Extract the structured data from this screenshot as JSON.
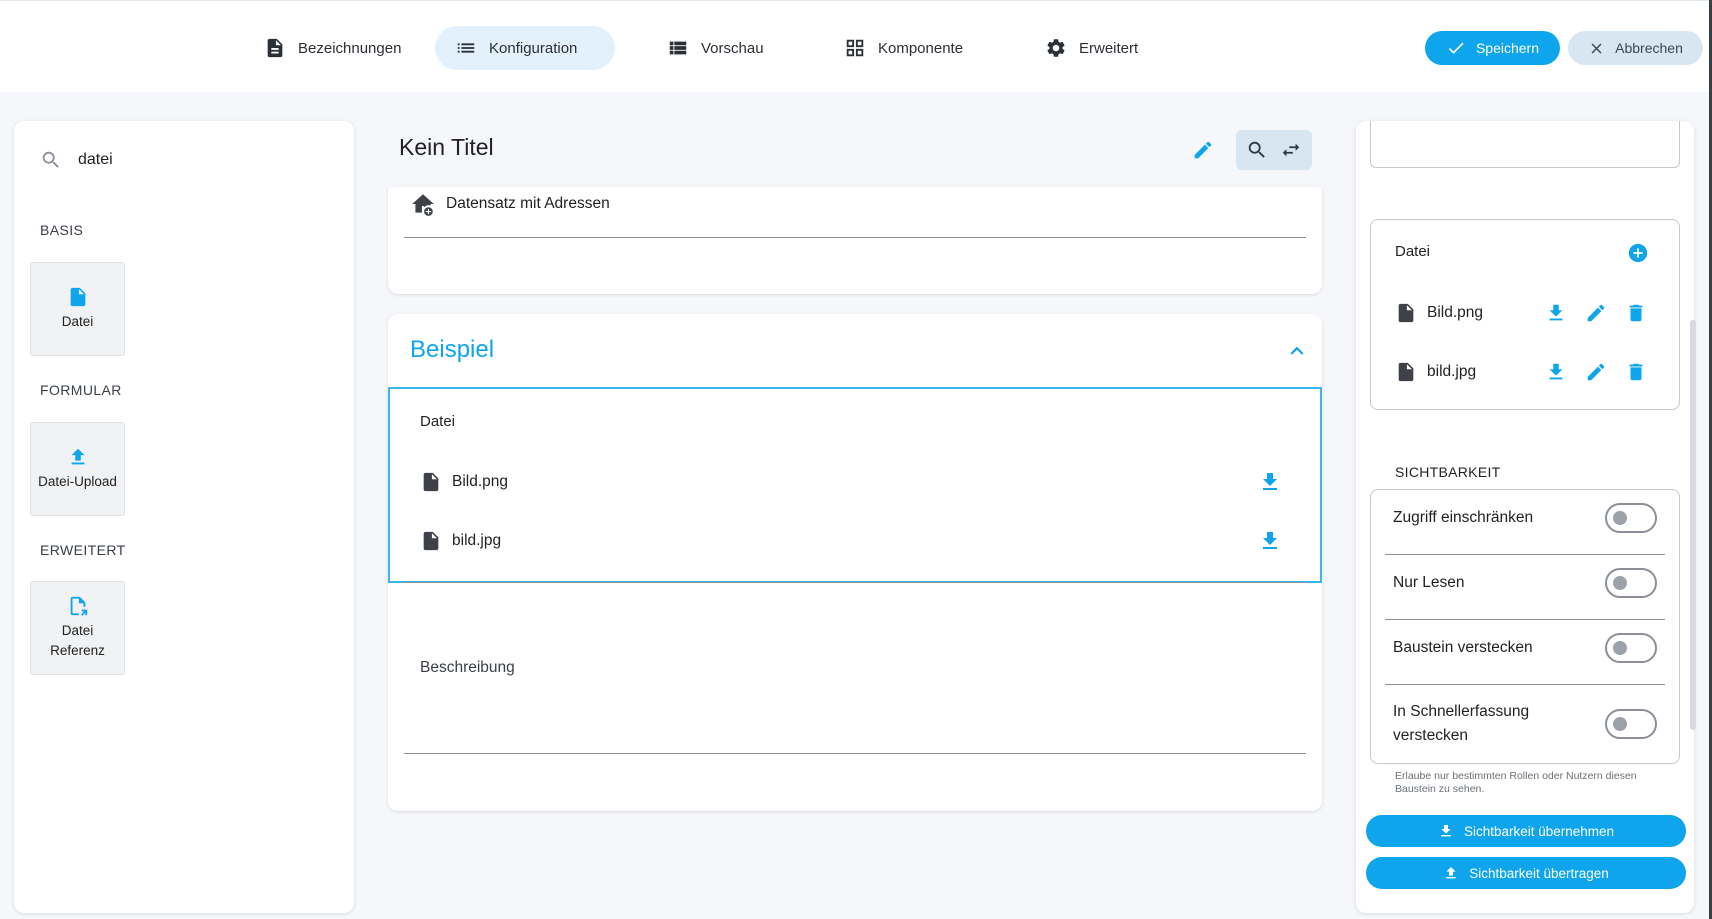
{
  "tabs": [
    {
      "label": "Bezeichnungen",
      "icon": "document-icon",
      "active": false
    },
    {
      "label": "Konfiguration",
      "icon": "list-icon",
      "active": true
    },
    {
      "label": "Vorschau",
      "icon": "view-list-icon",
      "active": false
    },
    {
      "label": "Komponente",
      "icon": "grid-icon",
      "active": false
    },
    {
      "label": "Erweitert",
      "icon": "gear-icon",
      "active": false
    }
  ],
  "actions": {
    "save_label": "Speichern",
    "cancel_label": "Abbrechen"
  },
  "palette": {
    "search_value": "datei",
    "sections": [
      {
        "label": "BASIS",
        "items": [
          {
            "label": "Datei",
            "icon": "file-icon"
          }
        ]
      },
      {
        "label": "FORMULAR",
        "items": [
          {
            "label": "Datei-Upload",
            "icon": "upload-icon"
          }
        ]
      },
      {
        "label": "ERWEITERT",
        "items": [
          {
            "label": "Datei Referenz",
            "icon": "file-link-icon"
          }
        ]
      }
    ]
  },
  "editor": {
    "title": "Kein Titel",
    "dataset_label": "Datensatz mit Adressen",
    "section_title": "Beispiel",
    "file_field_label": "Datei",
    "files": [
      "Bild.png",
      "bild.jpg"
    ],
    "description_label": "Beschreibung"
  },
  "properties": {
    "file_header": "Datei",
    "files": [
      "Bild.png",
      "bild.jpg"
    ],
    "visibility_heading": "SICHTBARKEIT",
    "toggles": [
      {
        "label": "Zugriff einschränken",
        "on": false
      },
      {
        "label": "Nur Lesen",
        "on": false
      },
      {
        "label": "Baustein verstecken",
        "on": false
      },
      {
        "label": "In Schnellerfassung verstecken",
        "on": false
      }
    ],
    "hint": "Erlaube nur bestimmten Rollen oder Nutzern diesen Baustein zu sehen.",
    "apply_visibility_label": "Sichtbarkeit übernehmen",
    "transfer_visibility_label": "Sichtbarkeit übertragen"
  },
  "colors": {
    "accent": "#0ea5ec",
    "active_tab_bg": "#e3f1fc",
    "cancel_bg": "#d8e6f1"
  }
}
